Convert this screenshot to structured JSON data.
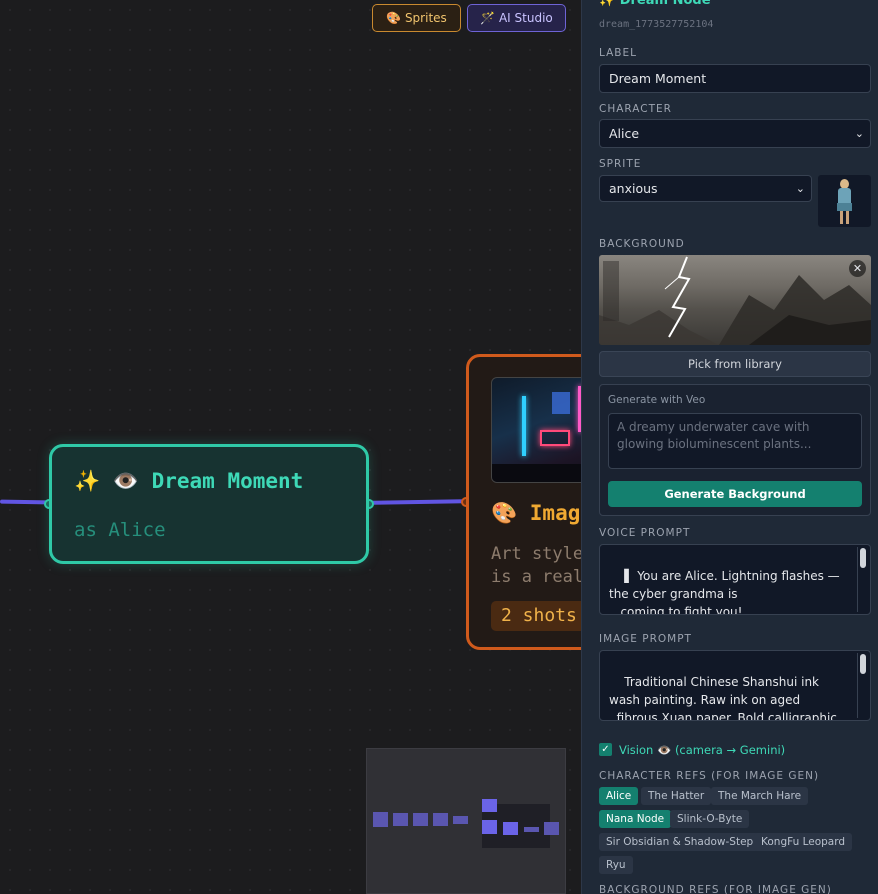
{
  "toolbar": {
    "sprites_label": "🎨 Sprites",
    "ai_studio_label": "🪄 AI Studio"
  },
  "canvas": {
    "dream_node": {
      "title": "✨ 👁️  Dream Moment",
      "subtitle": "as Alice"
    },
    "image_node": {
      "title": "🎨 Imag",
      "description": "Art style\nis a real",
      "shots_badge": "2 shots"
    }
  },
  "panel": {
    "header_title": "✨ Dream Node",
    "node_id": "dream_1773527752104",
    "label_heading": "LABEL",
    "label_value": "Dream Moment",
    "character_heading": "CHARACTER",
    "character_value": "Alice",
    "sprite_heading": "SPRITE",
    "sprite_value": "anxious",
    "background_heading": "BACKGROUND",
    "pick_library_label": "Pick from library",
    "veo": {
      "heading": "Generate with Veo",
      "placeholder": "A dreamy underwater cave with glowing bioluminescent plants...",
      "button_label": "Generate Background"
    },
    "voice_prompt_heading": "VOICE PROMPT",
    "voice_prompt_value": "▌ You are Alice. Lightning flashes — the cyber grandma is\n   coming to fight you!",
    "image_prompt_heading": "IMAGE PROMPT",
    "image_prompt_value": "Traditional Chinese Shanshui ink wash painting. Raw ink on aged\n  fibrous Xuan paper. Bold calligraphic brushstrokes, heavy",
    "vision_label": "Vision 👁️ (camera → Gemini)",
    "vision_checked": true,
    "character_refs_heading": "CHARACTER REFS (FOR IMAGE GEN)",
    "character_refs": [
      {
        "label": "Alice",
        "selected": true
      },
      {
        "label": "The Hatter",
        "selected": false
      },
      {
        "label": "The March Hare",
        "selected": false
      },
      {
        "label": "Nana Node",
        "selected": true
      },
      {
        "label": "Slink-O-Byte",
        "selected": false
      },
      {
        "label": "Sir Obsidian & Shadow-Step",
        "selected": false
      },
      {
        "label": "KongFu Leopard",
        "selected": false
      },
      {
        "label": "Ryu",
        "selected": false
      }
    ],
    "background_refs_heading": "BACKGROUND REFS (FOR IMAGE GEN)"
  },
  "colors": {
    "dream_accent": "#2fc9a7",
    "image_accent": "#d05a1c",
    "edge": "#6155e3",
    "panel_bg": "#1f2937",
    "chip_selected": "#14806f"
  }
}
